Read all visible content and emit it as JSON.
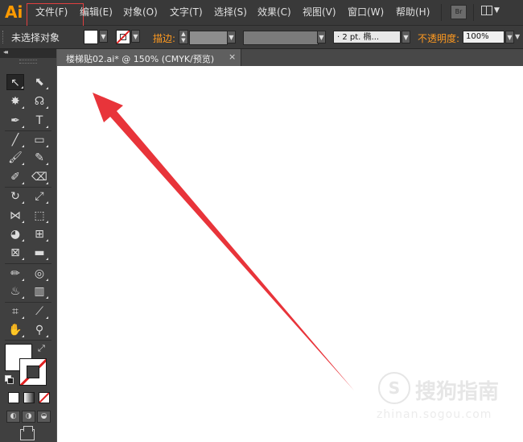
{
  "app": {
    "logo": "Ai"
  },
  "menu": {
    "items": [
      "文件(F)",
      "编辑(E)",
      "对象(O)",
      "文字(T)",
      "选择(S)",
      "效果(C)",
      "视图(V)",
      "窗口(W)",
      "帮助(H)"
    ],
    "highlighted_item": "文件(F)",
    "highlight_color": "#e04040",
    "bridge_label": "Br"
  },
  "control_bar": {
    "selection_status": "未选择对象",
    "stroke_label": "描边:",
    "brush_definition": "· 2 pt. 椭...",
    "opacity_label": "不透明度:",
    "opacity_value": "100%",
    "label_accent_color": "#ff9a20"
  },
  "document": {
    "tab_label": "楼梯贴02.ai* @ 150% (CMYK/预览)",
    "close_glyph": "×"
  },
  "tools": [
    {
      "name": "selection-tool",
      "glyph": "↖",
      "active": true
    },
    {
      "name": "direct-selection-tool",
      "glyph": "⬉"
    },
    {
      "name": "magic-wand-tool",
      "glyph": "✸"
    },
    {
      "name": "lasso-tool",
      "glyph": "☊"
    },
    {
      "name": "pen-tool",
      "glyph": "✒"
    },
    {
      "name": "type-tool",
      "glyph": "T"
    },
    {
      "name": "line-segment-tool",
      "glyph": "╱"
    },
    {
      "name": "rectangle-tool",
      "glyph": "▭"
    },
    {
      "name": "paintbrush-tool",
      "glyph": "🖌"
    },
    {
      "name": "pencil-tool",
      "glyph": "✎"
    },
    {
      "name": "blob-brush-tool",
      "glyph": "✐"
    },
    {
      "name": "eraser-tool",
      "glyph": "⌫"
    },
    {
      "name": "rotate-tool",
      "glyph": "↻"
    },
    {
      "name": "scale-tool",
      "glyph": "⤢"
    },
    {
      "name": "width-tool",
      "glyph": "⋈"
    },
    {
      "name": "free-transform-tool",
      "glyph": "⬚"
    },
    {
      "name": "shape-builder-tool",
      "glyph": "◕"
    },
    {
      "name": "perspective-grid-tool",
      "glyph": "⊞"
    },
    {
      "name": "mesh-tool",
      "glyph": "⊠"
    },
    {
      "name": "gradient-tool",
      "glyph": "▬"
    },
    {
      "name": "eyedropper-tool",
      "glyph": "✏"
    },
    {
      "name": "blend-tool",
      "glyph": "◎"
    },
    {
      "name": "symbol-sprayer-tool",
      "glyph": "♨"
    },
    {
      "name": "column-graph-tool",
      "glyph": "▥"
    },
    {
      "name": "artboard-tool",
      "glyph": "⌗"
    },
    {
      "name": "slice-tool",
      "glyph": "⟋"
    },
    {
      "name": "hand-tool",
      "glyph": "✋"
    },
    {
      "name": "zoom-tool",
      "glyph": "⚲"
    }
  ],
  "watermark": {
    "logo": "S",
    "text": "搜狗指南",
    "url": "zhinan.sogou.com"
  },
  "annotation": {
    "arrow_color": "#e8343a"
  }
}
